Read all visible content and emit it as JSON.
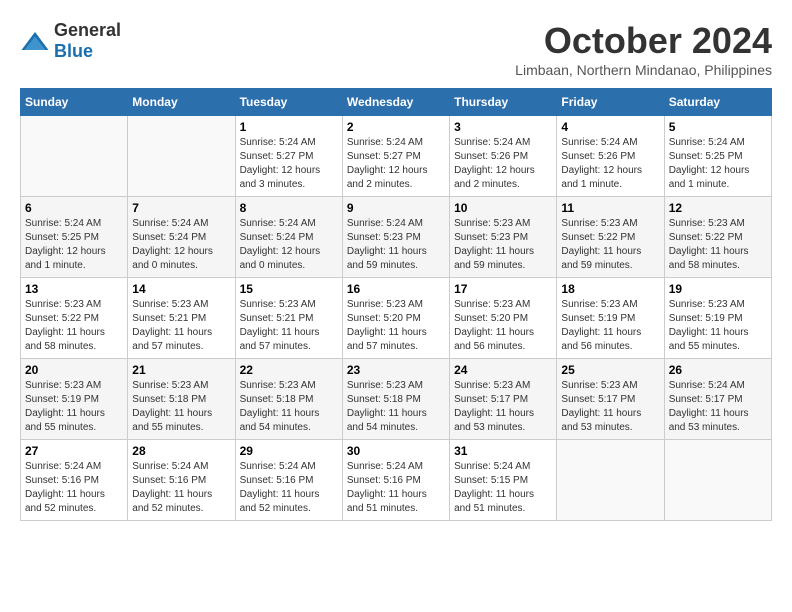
{
  "logo": {
    "general": "General",
    "blue": "Blue"
  },
  "header": {
    "month": "October 2024",
    "location": "Limbaan, Northern Mindanao, Philippines"
  },
  "weekdays": [
    "Sunday",
    "Monday",
    "Tuesday",
    "Wednesday",
    "Thursday",
    "Friday",
    "Saturday"
  ],
  "weeks": [
    [
      {
        "day": "",
        "sunrise": "",
        "sunset": "",
        "daylight": ""
      },
      {
        "day": "",
        "sunrise": "",
        "sunset": "",
        "daylight": ""
      },
      {
        "day": "1",
        "sunrise": "Sunrise: 5:24 AM",
        "sunset": "Sunset: 5:27 PM",
        "daylight": "Daylight: 12 hours and 3 minutes."
      },
      {
        "day": "2",
        "sunrise": "Sunrise: 5:24 AM",
        "sunset": "Sunset: 5:27 PM",
        "daylight": "Daylight: 12 hours and 2 minutes."
      },
      {
        "day": "3",
        "sunrise": "Sunrise: 5:24 AM",
        "sunset": "Sunset: 5:26 PM",
        "daylight": "Daylight: 12 hours and 2 minutes."
      },
      {
        "day": "4",
        "sunrise": "Sunrise: 5:24 AM",
        "sunset": "Sunset: 5:26 PM",
        "daylight": "Daylight: 12 hours and 1 minute."
      },
      {
        "day": "5",
        "sunrise": "Sunrise: 5:24 AM",
        "sunset": "Sunset: 5:25 PM",
        "daylight": "Daylight: 12 hours and 1 minute."
      }
    ],
    [
      {
        "day": "6",
        "sunrise": "Sunrise: 5:24 AM",
        "sunset": "Sunset: 5:25 PM",
        "daylight": "Daylight: 12 hours and 1 minute."
      },
      {
        "day": "7",
        "sunrise": "Sunrise: 5:24 AM",
        "sunset": "Sunset: 5:24 PM",
        "daylight": "Daylight: 12 hours and 0 minutes."
      },
      {
        "day": "8",
        "sunrise": "Sunrise: 5:24 AM",
        "sunset": "Sunset: 5:24 PM",
        "daylight": "Daylight: 12 hours and 0 minutes."
      },
      {
        "day": "9",
        "sunrise": "Sunrise: 5:24 AM",
        "sunset": "Sunset: 5:23 PM",
        "daylight": "Daylight: 11 hours and 59 minutes."
      },
      {
        "day": "10",
        "sunrise": "Sunrise: 5:23 AM",
        "sunset": "Sunset: 5:23 PM",
        "daylight": "Daylight: 11 hours and 59 minutes."
      },
      {
        "day": "11",
        "sunrise": "Sunrise: 5:23 AM",
        "sunset": "Sunset: 5:22 PM",
        "daylight": "Daylight: 11 hours and 59 minutes."
      },
      {
        "day": "12",
        "sunrise": "Sunrise: 5:23 AM",
        "sunset": "Sunset: 5:22 PM",
        "daylight": "Daylight: 11 hours and 58 minutes."
      }
    ],
    [
      {
        "day": "13",
        "sunrise": "Sunrise: 5:23 AM",
        "sunset": "Sunset: 5:22 PM",
        "daylight": "Daylight: 11 hours and 58 minutes."
      },
      {
        "day": "14",
        "sunrise": "Sunrise: 5:23 AM",
        "sunset": "Sunset: 5:21 PM",
        "daylight": "Daylight: 11 hours and 57 minutes."
      },
      {
        "day": "15",
        "sunrise": "Sunrise: 5:23 AM",
        "sunset": "Sunset: 5:21 PM",
        "daylight": "Daylight: 11 hours and 57 minutes."
      },
      {
        "day": "16",
        "sunrise": "Sunrise: 5:23 AM",
        "sunset": "Sunset: 5:20 PM",
        "daylight": "Daylight: 11 hours and 57 minutes."
      },
      {
        "day": "17",
        "sunrise": "Sunrise: 5:23 AM",
        "sunset": "Sunset: 5:20 PM",
        "daylight": "Daylight: 11 hours and 56 minutes."
      },
      {
        "day": "18",
        "sunrise": "Sunrise: 5:23 AM",
        "sunset": "Sunset: 5:19 PM",
        "daylight": "Daylight: 11 hours and 56 minutes."
      },
      {
        "day": "19",
        "sunrise": "Sunrise: 5:23 AM",
        "sunset": "Sunset: 5:19 PM",
        "daylight": "Daylight: 11 hours and 55 minutes."
      }
    ],
    [
      {
        "day": "20",
        "sunrise": "Sunrise: 5:23 AM",
        "sunset": "Sunset: 5:19 PM",
        "daylight": "Daylight: 11 hours and 55 minutes."
      },
      {
        "day": "21",
        "sunrise": "Sunrise: 5:23 AM",
        "sunset": "Sunset: 5:18 PM",
        "daylight": "Daylight: 11 hours and 55 minutes."
      },
      {
        "day": "22",
        "sunrise": "Sunrise: 5:23 AM",
        "sunset": "Sunset: 5:18 PM",
        "daylight": "Daylight: 11 hours and 54 minutes."
      },
      {
        "day": "23",
        "sunrise": "Sunrise: 5:23 AM",
        "sunset": "Sunset: 5:18 PM",
        "daylight": "Daylight: 11 hours and 54 minutes."
      },
      {
        "day": "24",
        "sunrise": "Sunrise: 5:23 AM",
        "sunset": "Sunset: 5:17 PM",
        "daylight": "Daylight: 11 hours and 53 minutes."
      },
      {
        "day": "25",
        "sunrise": "Sunrise: 5:23 AM",
        "sunset": "Sunset: 5:17 PM",
        "daylight": "Daylight: 11 hours and 53 minutes."
      },
      {
        "day": "26",
        "sunrise": "Sunrise: 5:24 AM",
        "sunset": "Sunset: 5:17 PM",
        "daylight": "Daylight: 11 hours and 53 minutes."
      }
    ],
    [
      {
        "day": "27",
        "sunrise": "Sunrise: 5:24 AM",
        "sunset": "Sunset: 5:16 PM",
        "daylight": "Daylight: 11 hours and 52 minutes."
      },
      {
        "day": "28",
        "sunrise": "Sunrise: 5:24 AM",
        "sunset": "Sunset: 5:16 PM",
        "daylight": "Daylight: 11 hours and 52 minutes."
      },
      {
        "day": "29",
        "sunrise": "Sunrise: 5:24 AM",
        "sunset": "Sunset: 5:16 PM",
        "daylight": "Daylight: 11 hours and 52 minutes."
      },
      {
        "day": "30",
        "sunrise": "Sunrise: 5:24 AM",
        "sunset": "Sunset: 5:16 PM",
        "daylight": "Daylight: 11 hours and 51 minutes."
      },
      {
        "day": "31",
        "sunrise": "Sunrise: 5:24 AM",
        "sunset": "Sunset: 5:15 PM",
        "daylight": "Daylight: 11 hours and 51 minutes."
      },
      {
        "day": "",
        "sunrise": "",
        "sunset": "",
        "daylight": ""
      },
      {
        "day": "",
        "sunrise": "",
        "sunset": "",
        "daylight": ""
      }
    ]
  ]
}
